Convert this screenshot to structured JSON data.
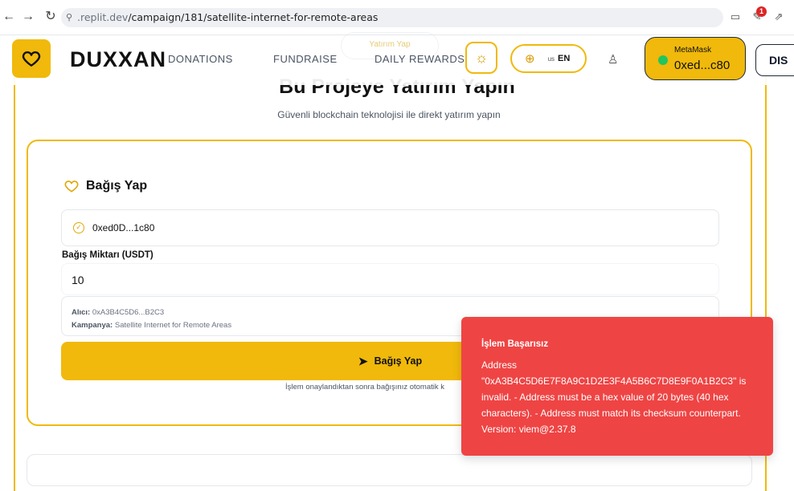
{
  "browser": {
    "url_prefix": ".replit.dev",
    "url_path": "/campaign/181/satellite-internet-for-remote-areas",
    "notification_count": "1"
  },
  "header": {
    "brand": "DUXXAN",
    "nav": [
      "DONATIONS",
      "FUNDRAISE",
      "DAILY REWARDS"
    ],
    "ghost_pill": "Yatırım Yap",
    "lang_flag": "us",
    "lang_code": "EN",
    "wallet_label": "MetaMask",
    "wallet_addr": "0xed...c80",
    "disconnect": "DIS"
  },
  "hero": {
    "title": "Bu Projeye Yatırım Yapın",
    "subtitle": "Güvenli blockchain teknolojisi ile direkt yatırım yapın"
  },
  "donate": {
    "heading": "Bağış Yap",
    "wallet": "0xed0D...1c80",
    "amount_label": "Bağış Miktarı (USDT)",
    "amount": "10",
    "recipient_label": "Alıcı:",
    "recipient": "0xA3B4C5D6...B2C3",
    "campaign_label": "Kampanya:",
    "campaign": "Satellite Internet for Remote Areas",
    "button": "Bağış Yap",
    "footnote": "İşlem onaylandıktan sonra bağışınız otomatik k"
  },
  "toast": {
    "title": "İşlem Başarısız",
    "message": "Address \"0xA3B4C5D6E7F8A9C1D2E3F4A5B6C7D8E9F0A1B2C3\" is invalid. - Address must be a hex value of 20 bytes (40 hex characters). - Address must match its checksum counterpart. Version: viem@2.37.8"
  },
  "colors": {
    "accent": "#f0b90b",
    "error": "#ef4444",
    "online": "#22c55e"
  }
}
